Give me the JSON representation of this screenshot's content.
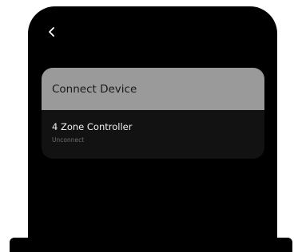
{
  "header": {
    "back_icon": "chevron-left-icon"
  },
  "card": {
    "title": "Connect Device",
    "devices": [
      {
        "name": "4 Zone Controller",
        "status": "Unconnect"
      }
    ]
  },
  "colors": {
    "screen_bg": "#000000",
    "card_header_bg": "#9a9a9a",
    "card_body_bg": "#121212",
    "text_primary": "#f2f2f2",
    "text_secondary": "#6e6e6e"
  }
}
